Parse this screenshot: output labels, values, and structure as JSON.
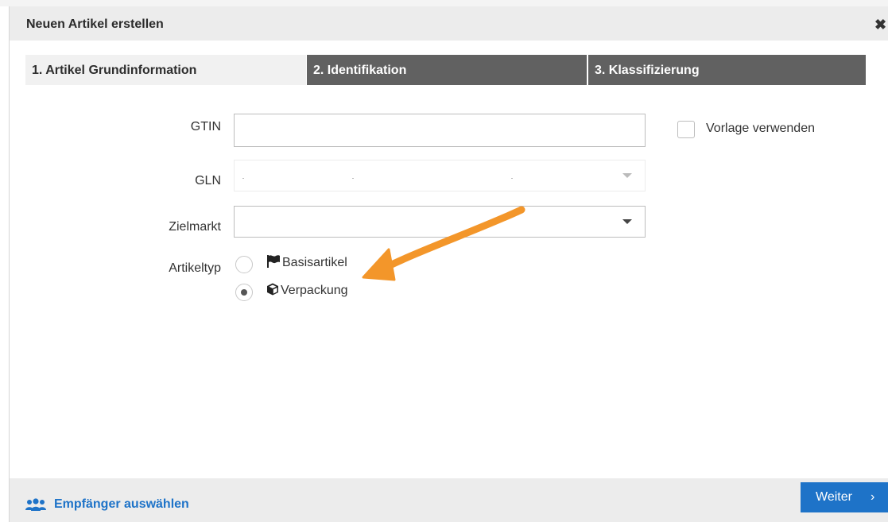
{
  "dialog": {
    "title": "Neuen Artikel erstellen",
    "close_icon": "close-icon"
  },
  "tabs": [
    {
      "label": "1. Artikel Grundinformation",
      "active": true
    },
    {
      "label": "2. Identifikation",
      "active": false
    },
    {
      "label": "3. Klassifizierung",
      "active": false
    }
  ],
  "form": {
    "gtin": {
      "label": "GTIN",
      "value": ""
    },
    "gln": {
      "label": "GLN",
      "value": ""
    },
    "zielmarkt": {
      "label": "Zielmarkt",
      "value": ""
    },
    "artikeltyp": {
      "label": "Artikeltyp",
      "options": [
        {
          "label": "Basisartikel",
          "icon": "flag-icon",
          "selected": false
        },
        {
          "label": "Verpackung",
          "icon": "cube-icon",
          "selected": true
        }
      ]
    },
    "template": {
      "label": "Vorlage verwenden",
      "checked": false
    }
  },
  "footer": {
    "recipients_label": "Empfänger auswählen",
    "recipients_icon": "users-icon",
    "next_label": "Weiter",
    "next_icon": "chevron-right-icon"
  },
  "colors": {
    "accent": "#1e73c8",
    "tab_inactive": "#616161",
    "tab_active": "#f1f1f1",
    "annotation_arrow": "#f3962a"
  }
}
